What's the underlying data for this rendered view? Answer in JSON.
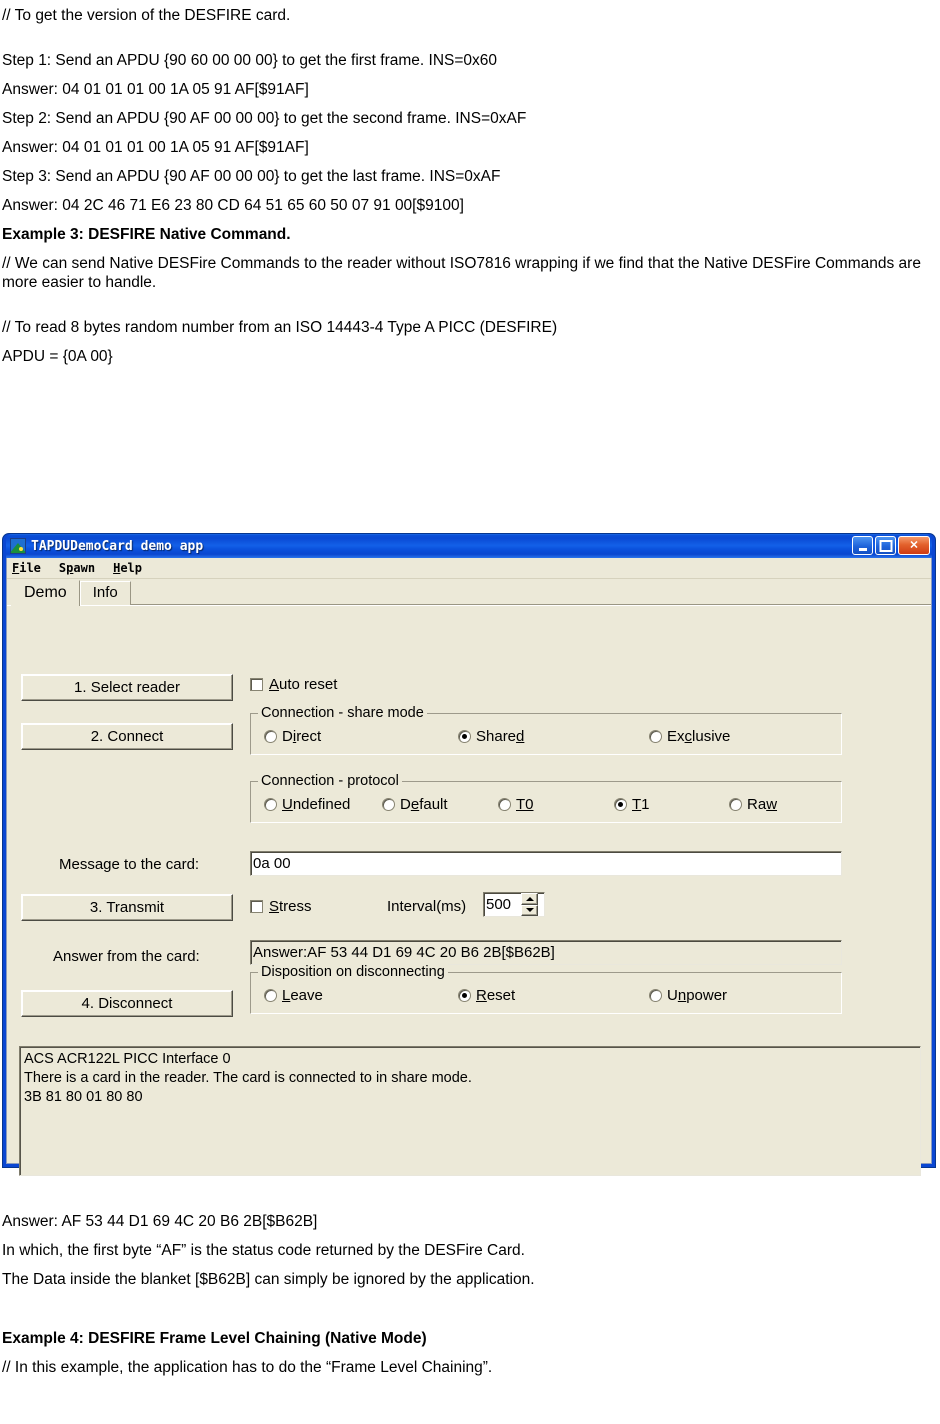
{
  "document": {
    "before_paragraphs": [
      "// To get the version of the DESFIRE card.",
      "Step 1: Send an APDU {90 60 00 00 00} to get the first frame. INS=0x60",
      "Answer: 04 01 01 01 00 1A 05 91 AF[$91AF]",
      "Step 2: Send an APDU {90 AF 00 00 00} to get the second frame. INS=0xAF",
      "Answer: 04 01 01 01 00 1A 05 91 AF[$91AF]",
      "Step 3: Send an APDU {90 AF 00 00 00} to get the last frame. INS=0xAF",
      "Answer: 04 2C 46 71 E6 23 80 CD 64 51 65 60 50 07 91 00[$9100]"
    ],
    "example3_heading": "Example 3: DESFIRE Native Command.",
    "example3_note": "// We can send Native DESFire Commands to the reader without ISO7816 wrapping if we find that the Native DESFire Commands are more easier to handle.",
    "read_note": "// To read 8 bytes random number from an ISO 14443-4 Type A PICC (DESFIRE)",
    "apdu_line": "APDU = {0A 00}",
    "after_paragraphs": [
      "Answer: AF 53 44 D1 69 4C 20 B6 2B[$B62B]",
      "In which, the first byte “AF” is the status code returned by the DESFire Card.",
      "The Data inside the blanket [$B62B] can simply be ignored by the application."
    ],
    "example4_heading": "Example 4:  DESFIRE Frame Level Chaining (Native Mode)",
    "example4_note": "// In this example, the application has to do the “Frame Level Chaining”."
  },
  "app_window": {
    "title": "TAPDUDemoCard demo app",
    "window_buttons": {
      "minimize": "minimize",
      "maximize": "maximize",
      "close": "✕"
    },
    "menu": [
      {
        "label": "File",
        "accelerator": "F"
      },
      {
        "label": "Spawn",
        "accelerator": "p"
      },
      {
        "label": "Help",
        "accelerator": "H"
      }
    ],
    "tabs": [
      {
        "label": "Demo",
        "active": true
      },
      {
        "label": "Info",
        "active": false
      }
    ],
    "buttons": {
      "select_reader": "1. Select reader",
      "connect": "2. Connect",
      "transmit": "3. Transmit",
      "disconnect": "4. Disconnect"
    },
    "auto_reset": {
      "label": "Auto reset",
      "checked": false
    },
    "share_mode": {
      "legend": "Connection - share mode",
      "options": [
        "Direct",
        "Shared",
        "Exclusive"
      ],
      "selected": "Shared"
    },
    "protocol": {
      "legend": "Connection - protocol",
      "options": [
        "Undefined",
        "Default",
        "T0",
        "T1",
        "Raw"
      ],
      "selected": "T1"
    },
    "message_to_card": {
      "label": "Message to the card:",
      "value": "0a 00"
    },
    "stress": {
      "label": "Stress",
      "checked": false
    },
    "interval": {
      "label": "Interval(ms)",
      "value": "500"
    },
    "answer_from_card": {
      "label": "Answer from the card:",
      "value": "Answer:AF 53 44 D1 69 4C 20 B6 2B[$B62B]"
    },
    "disposition": {
      "legend": "Disposition on disconnecting",
      "options": [
        "Leave",
        "Reset",
        "Unpower"
      ],
      "selected": "Reset"
    },
    "status_log": [
      "ACS ACR122L PICC Interface 0",
      "There is a card in the reader. The card is connected to in share mode.",
      "3B 81 80 01 80 80"
    ]
  },
  "colors": {
    "title_blue": "#0a4fd8",
    "window_face": "#ece9d8",
    "close_red": "#cf3b12",
    "field_white": "#ffffff"
  }
}
